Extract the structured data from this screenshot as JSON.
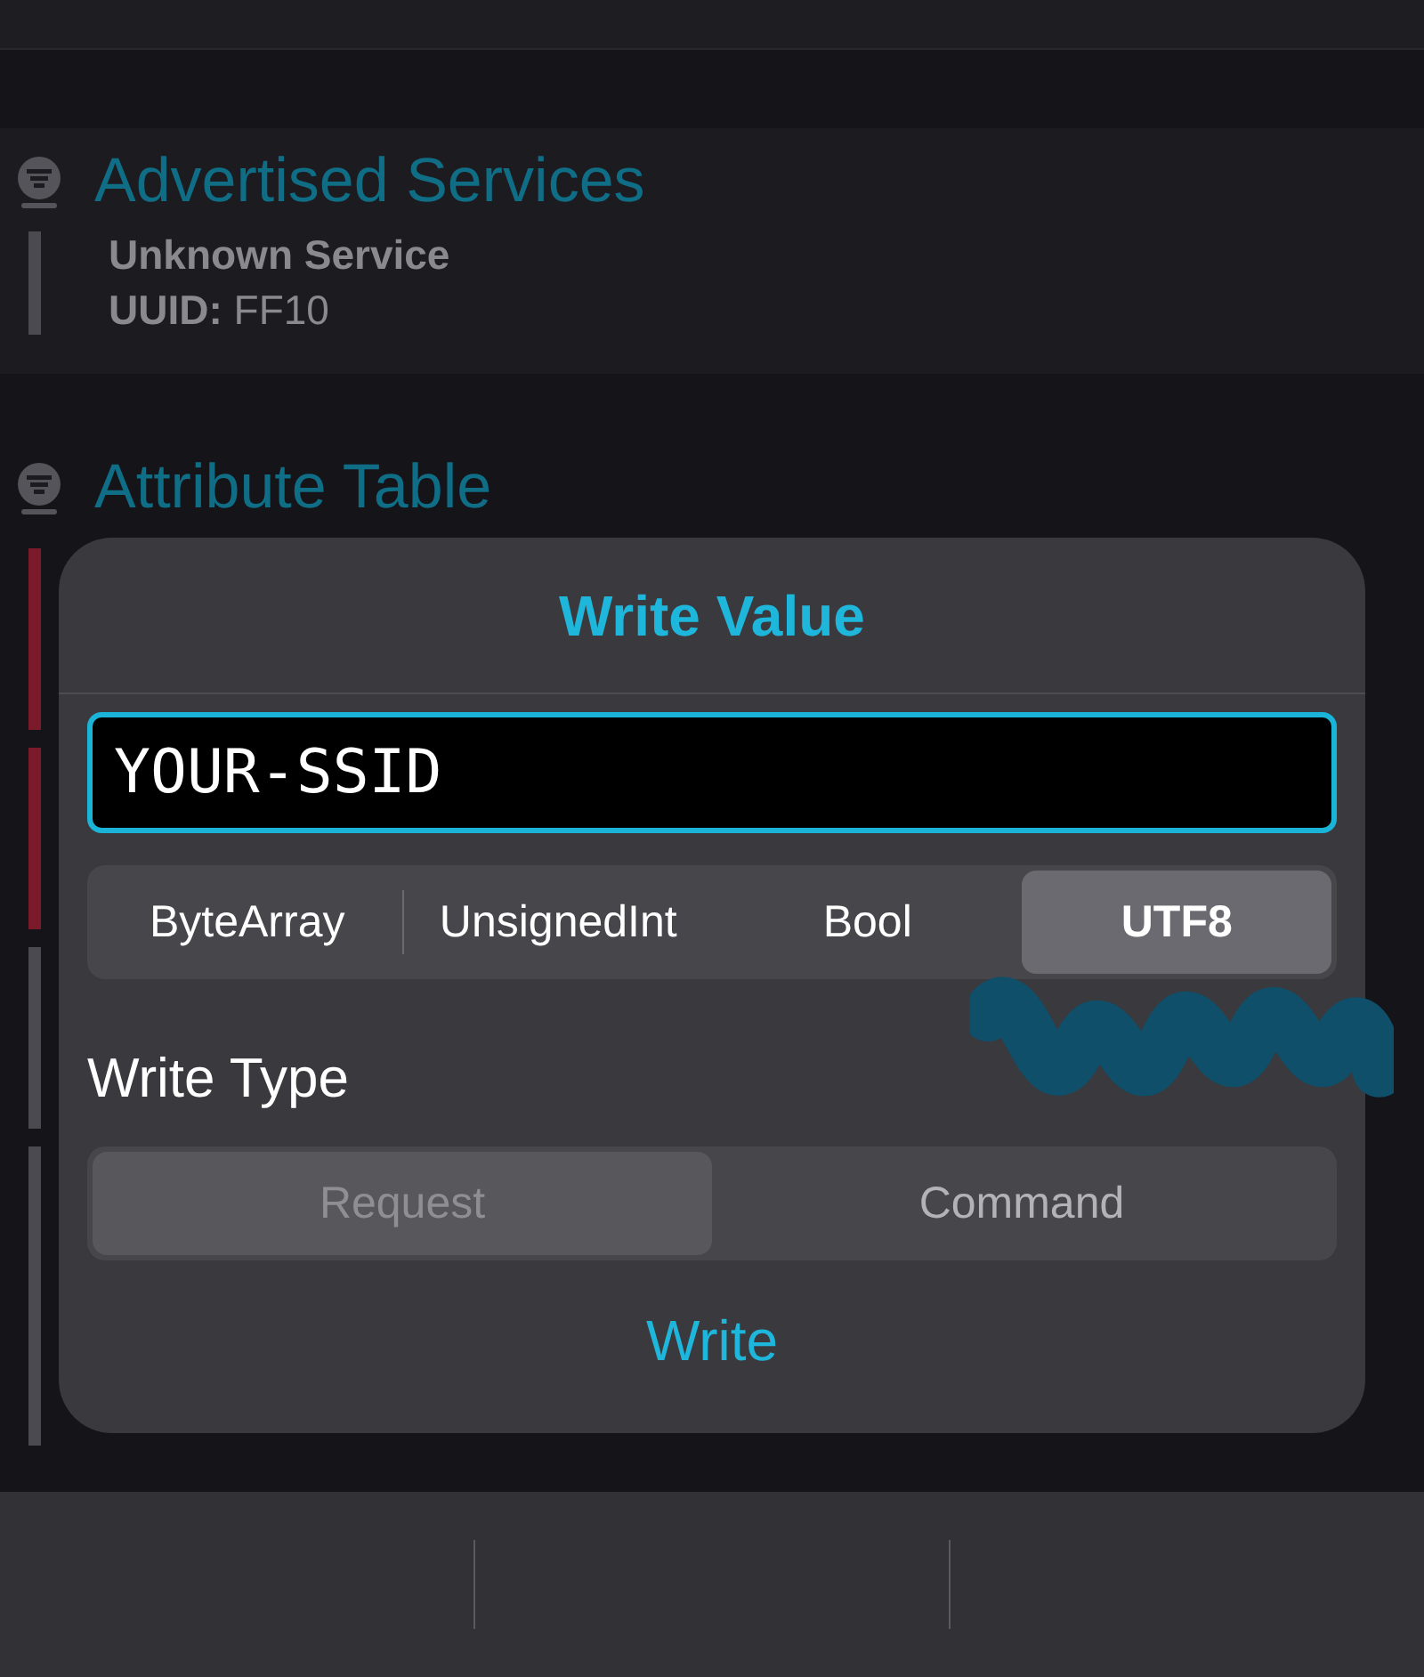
{
  "sections": [
    {
      "title": "Advertised Services",
      "items": [
        {
          "name": "Unknown Service",
          "detail": "**UUID:** FF10"
        }
      ]
    },
    {
      "title": "Attribute Table",
      "rows": [
        {
          "color": "#7a1a2a"
        },
        {
          "color": "#7a1a2a"
        },
        {
          "color": "#4a4a50"
        },
        {
          "color": "#4a4a50"
        }
      ]
    }
  ],
  "dialog": {
    "title": "Write Value",
    "input": {
      "value": "YOUR-SSID"
    },
    "formats": [
      {
        "label": "ByteArray",
        "selected": false
      },
      {
        "label": "UnsignedInt",
        "selected": false
      },
      {
        "label": "Bool",
        "selected": false
      },
      {
        "label": "UTF8",
        "selected": true
      }
    ],
    "write_type_label": "Write Type",
    "write_types": [
      {
        "label": "Request",
        "selected": true
      },
      {
        "label": "Command",
        "selected": false
      }
    ],
    "action": "Write"
  }
}
